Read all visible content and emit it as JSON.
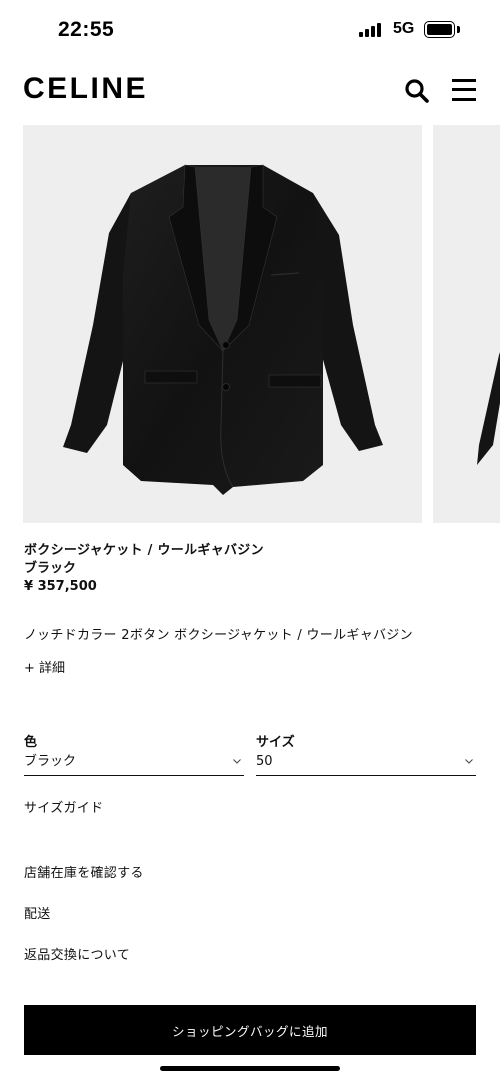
{
  "status_bar": {
    "time": "22:55",
    "network": "5G"
  },
  "header": {
    "logo": "CELINE",
    "icons": [
      "search-icon",
      "menu-icon"
    ]
  },
  "gallery": {
    "images": [
      "jacket-front-image",
      "jacket-back-image-partial"
    ],
    "background_color": "#eeeeee"
  },
  "product": {
    "name": "ボクシージャケット / ウールギャバジン",
    "color": "ブラック",
    "price": "¥ 357,500",
    "description": "ノッチドカラー 2ボタン ボクシージャケット / ウールギャバジン",
    "details_link": "+ 詳細"
  },
  "selectors": {
    "color": {
      "label": "色",
      "value": "ブラック"
    },
    "size": {
      "label": "サイズ",
      "value": "50"
    }
  },
  "links": {
    "size_guide": "サイズガイド",
    "store_stock": "店舗在庫を確認する",
    "shipping": "配送",
    "returns": "返品交換について"
  },
  "cta": {
    "add_to_bag": "ショッピングバッグに追加"
  }
}
